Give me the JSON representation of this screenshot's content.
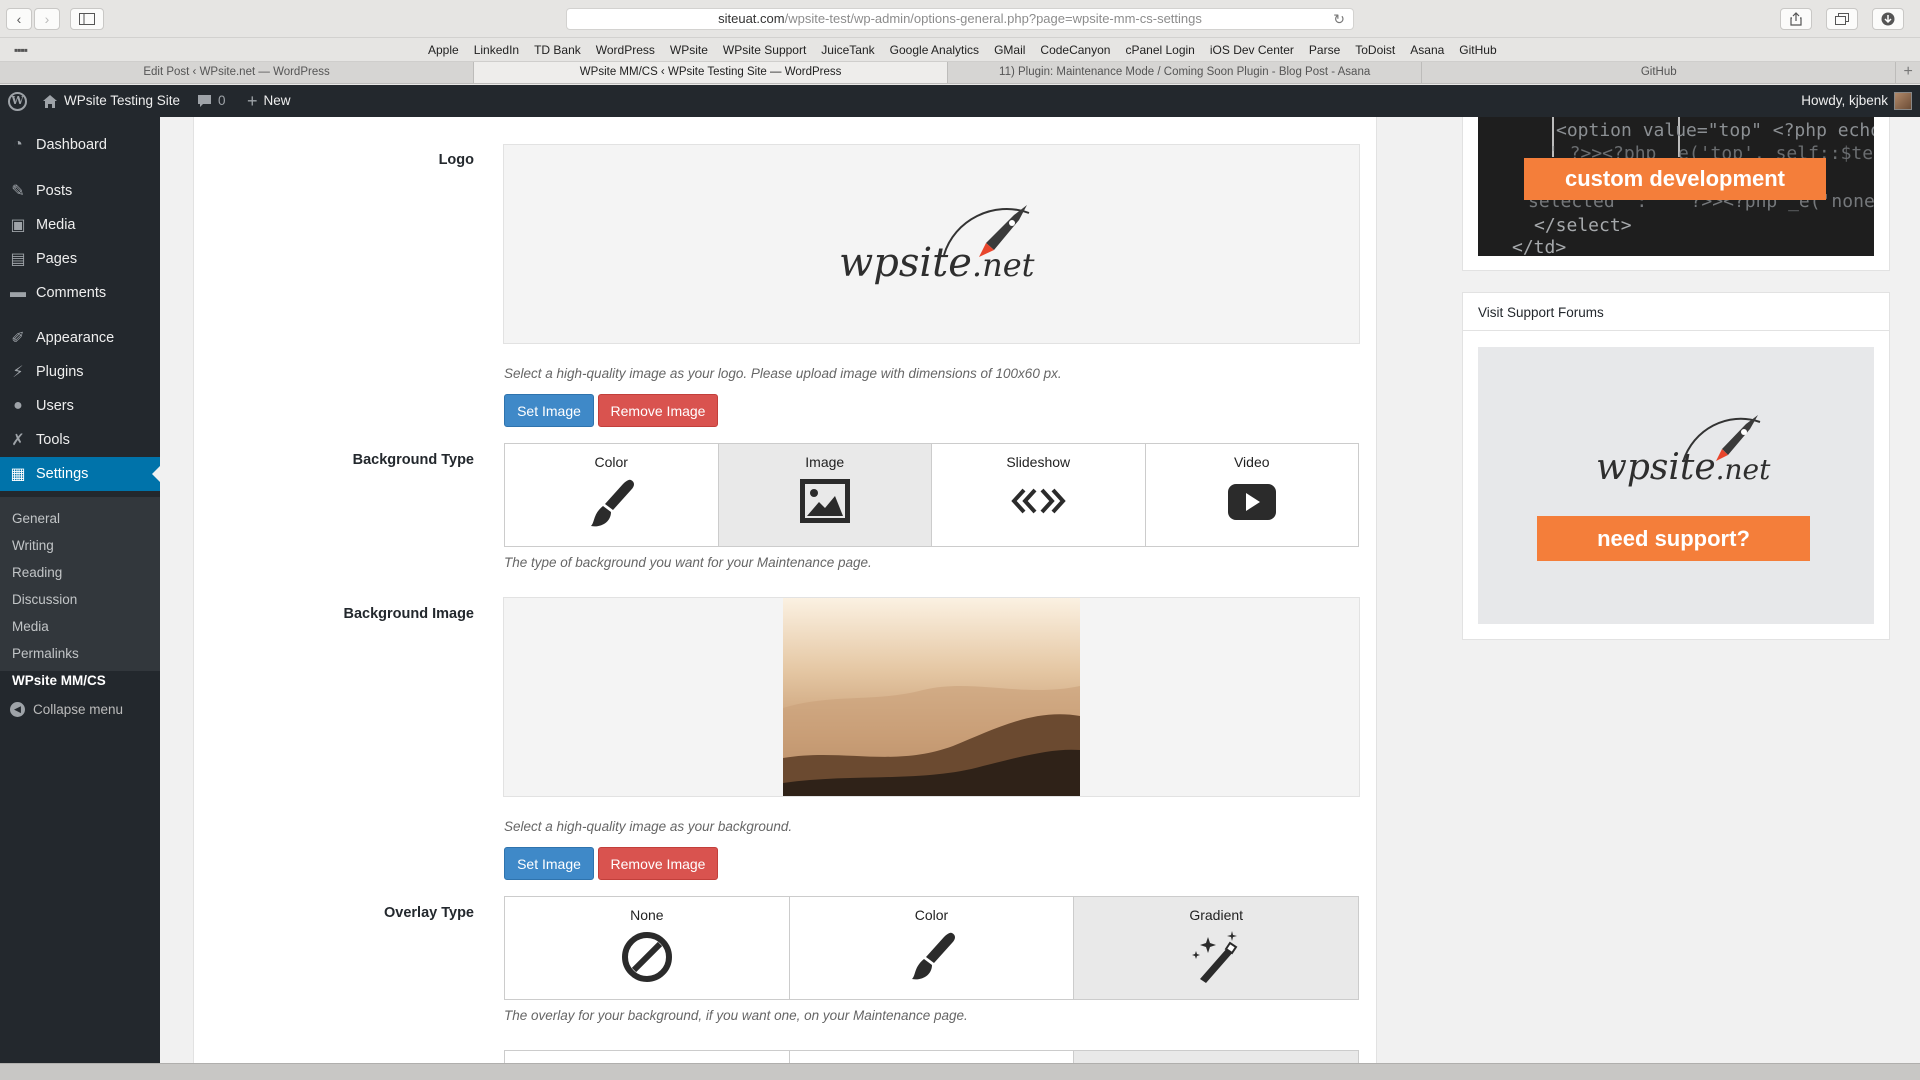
{
  "browser": {
    "url_host": "siteuat.com",
    "url_path": "/wpsite-test/wp-admin/options-general.php?page=wpsite-mm-cs-settings",
    "bookmarks": [
      "Apple",
      "LinkedIn",
      "TD Bank",
      "WordPress",
      "WPsite",
      "WPsite Support",
      "JuiceTank",
      "Google Analytics",
      "GMail",
      "CodeCanyon",
      "cPanel Login",
      "iOS Dev Center",
      "Parse",
      "ToDoist",
      "Asana",
      "GitHub"
    ],
    "tabs": [
      {
        "label": "Edit Post ‹ WPsite.net — WordPress",
        "active": false
      },
      {
        "label": "WPsite MM/CS ‹ WPsite Testing Site — WordPress",
        "active": true
      },
      {
        "label": "11) Plugin: Maintenance Mode / Coming Soon Plugin - Blog Post - Asana",
        "active": false
      },
      {
        "label": "GitHub",
        "active": false
      }
    ]
  },
  "adminbar": {
    "site_name": "WPsite Testing Site",
    "comments_count": "0",
    "new_label": "New",
    "howdy": "Howdy, kjbenk"
  },
  "sidebar": {
    "items": [
      {
        "label": "Dashboard",
        "icon": "dashboard-icon"
      },
      {
        "label": "Posts",
        "icon": "pin-icon"
      },
      {
        "label": "Media",
        "icon": "media-icon"
      },
      {
        "label": "Pages",
        "icon": "pages-icon"
      },
      {
        "label": "Comments",
        "icon": "comment-icon"
      },
      {
        "label": "Appearance",
        "icon": "paintbrush-icon"
      },
      {
        "label": "Plugins",
        "icon": "plug-icon"
      },
      {
        "label": "Users",
        "icon": "user-icon"
      },
      {
        "label": "Tools",
        "icon": "wrench-icon"
      },
      {
        "label": "Settings",
        "icon": "settings-icon"
      }
    ],
    "submenu": [
      "General",
      "Writing",
      "Reading",
      "Discussion",
      "Media",
      "Permalinks",
      "WPsite MM/CS"
    ],
    "collapse_label": "Collapse menu"
  },
  "main": {
    "logo": {
      "label": "Logo",
      "brand_text": "wpsite",
      "brand_suffix": ".net",
      "desc": "Select a high-quality image as your logo. Please upload image with dimensions of 100x60 px.",
      "set_label": "Set Image",
      "remove_label": "Remove Image"
    },
    "background_type": {
      "label": "Background Type",
      "options": [
        "Color",
        "Image",
        "Slideshow",
        "Video"
      ],
      "selected": "Image",
      "desc": "The type of background you want for your Maintenance page."
    },
    "background_image": {
      "label": "Background Image",
      "desc": "Select a high-quality image as your background.",
      "set_label": "Set Image",
      "remove_label": "Remove Image"
    },
    "overlay_type": {
      "label": "Overlay Type",
      "options": [
        "None",
        "Color",
        "Gradient"
      ],
      "selected": "Gradient",
      "desc": "The overlay for your background, if you want one, on your Maintenance page."
    }
  },
  "right_sidebar": {
    "dev_code_lines": [
      "<option value=\"top\" <?php echo is",
      "' ?>><?php _e('top', self::$text_d",
      "selected' : '' ?>><?php _e('none'",
      "</select>",
      "</td>"
    ],
    "dev_button": "custom development",
    "support_title": "Visit Support Forums",
    "support_button": "need support?"
  },
  "colors": {
    "admin_bar": "#23282d",
    "accent_blue": "#0073aa",
    "button_blue": "#3f89c8",
    "button_red": "#d9534f",
    "orange": "#f47e3a"
  }
}
